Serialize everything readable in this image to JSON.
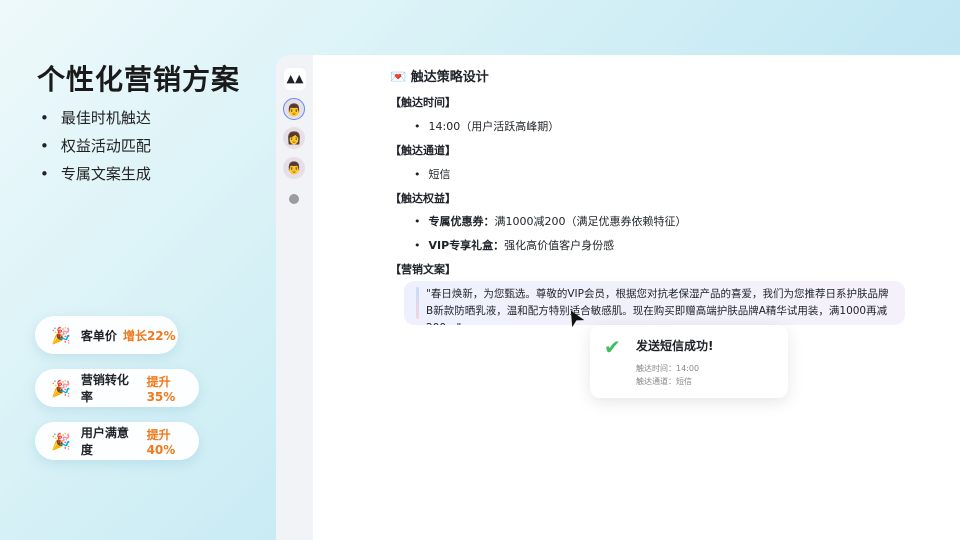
{
  "title": "个性化营销方案",
  "bullets": [
    "最佳时机触达",
    "权益活动匹配",
    "专属文案生成"
  ],
  "metrics": [
    {
      "icon": "party-popper-icon",
      "label": "客单价",
      "value": "增长22%"
    },
    {
      "icon": "party-popper-icon",
      "label": "营销转化率",
      "value": "提升35%"
    },
    {
      "icon": "party-popper-icon",
      "label": "用户满意度",
      "value": "提升40%"
    }
  ],
  "colors": {
    "accent": "#f07a1a",
    "success": "#3cc05a"
  },
  "content": {
    "heading": "触达策略设计",
    "time_label": "【触达时间】",
    "time_value": "14:00（用户活跃高峰期）",
    "channel_label": "【触达通道】",
    "channel_value": "短信",
    "benefit_label": "【触达权益】",
    "benefits": [
      {
        "name": "专属优惠券：",
        "desc": "满1000减200（满足优惠券依赖特征）"
      },
      {
        "name": "VIP专享礼盒：",
        "desc": "强化高价值客户身份感"
      }
    ],
    "copy_label": "【营销文案】",
    "copy": "\"春日焕新，为您甄选。尊敬的VIP会员，根据您对抗老保湿产品的喜爱，我们为您推荐日系护肤品牌B新款防晒乳液，温和配方特别适合敏感肌。现在购买即赠高端护肤品牌A精华试用装，满1000再减200。\""
  },
  "toast": {
    "title": "发送短信成功!",
    "time": "触达时间：14:00",
    "channel": "触达通道：短信"
  }
}
